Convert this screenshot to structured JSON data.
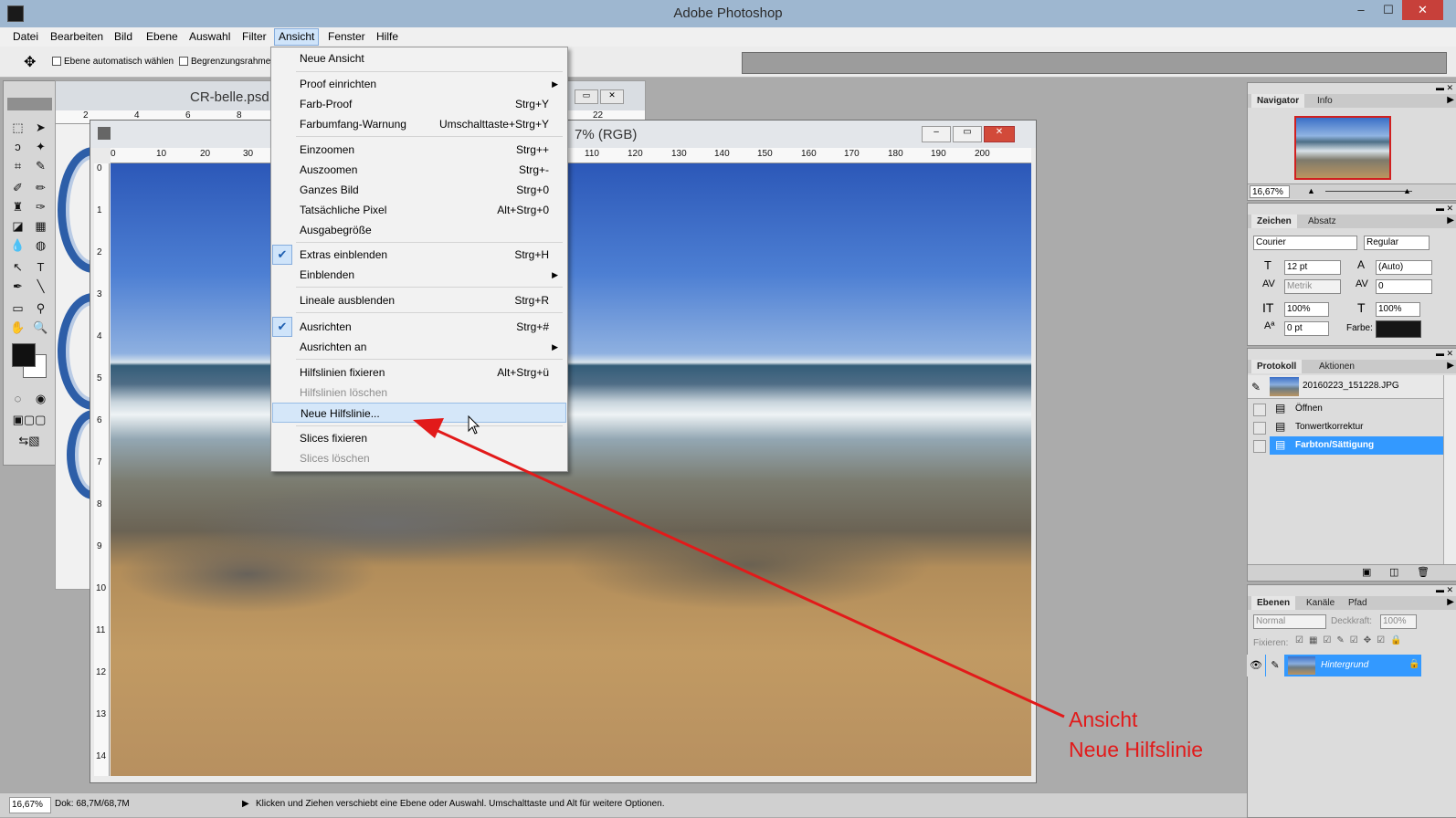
{
  "app": {
    "title": "Adobe Photoshop",
    "win_min": "–",
    "win_max": "☐",
    "win_close": "✕"
  },
  "menubar": {
    "items": [
      "Datei",
      "Bearbeiten",
      "Bild",
      "Ebene",
      "Auswahl",
      "Filter",
      "Ansicht",
      "Fenster",
      "Hilfe"
    ],
    "active": "Ansicht"
  },
  "options": {
    "auto_select_label": "Ebene automatisch wählen",
    "bounds_label": "Begrenzungsrahmen"
  },
  "back_doc": {
    "title": "CR-belle.psd",
    "ruler": [
      "2",
      "4",
      "6",
      "8",
      "22"
    ]
  },
  "main_doc": {
    "title": "7% (RGB)",
    "ruler_top": [
      "0",
      "10",
      "20",
      "30",
      "110",
      "120",
      "130",
      "140",
      "150",
      "160",
      "170",
      "180",
      "190",
      "200"
    ],
    "ruler_left": [
      "0",
      "1",
      "2",
      "3",
      "4",
      "5",
      "6",
      "7",
      "8",
      "9",
      "10",
      "11",
      "12",
      "13",
      "14"
    ]
  },
  "view_menu": {
    "items": [
      {
        "label": "Neue Ansicht",
        "shortcut": ""
      },
      {
        "label": "Proof einrichten",
        "shortcut": "",
        "submenu": true
      },
      {
        "label": "Farb-Proof",
        "shortcut": "Strg+Y"
      },
      {
        "label": "Farbumfang-Warnung",
        "shortcut": "Umschalttaste+Strg+Y"
      },
      {
        "label": "Einzoomen",
        "shortcut": "Strg++"
      },
      {
        "label": "Auszoomen",
        "shortcut": "Strg+-"
      },
      {
        "label": "Ganzes Bild",
        "shortcut": "Strg+0"
      },
      {
        "label": "Tatsächliche Pixel",
        "shortcut": "Alt+Strg+0"
      },
      {
        "label": "Ausgabegröße",
        "shortcut": ""
      },
      {
        "label": "Extras einblenden",
        "shortcut": "Strg+H",
        "checked": true
      },
      {
        "label": "Einblenden",
        "shortcut": "",
        "submenu": true
      },
      {
        "label": "Lineale ausblenden",
        "shortcut": "Strg+R"
      },
      {
        "label": "Ausrichten",
        "shortcut": "Strg+#",
        "checked": true
      },
      {
        "label": "Ausrichten an",
        "shortcut": "",
        "submenu": true
      },
      {
        "label": "Hilfslinien fixieren",
        "shortcut": "Alt+Strg+ü"
      },
      {
        "label": "Hilfslinien löschen",
        "shortcut": "",
        "disabled": true
      },
      {
        "label": "Neue Hilfslinie...",
        "shortcut": "",
        "hover": true
      },
      {
        "label": "Slices fixieren",
        "shortcut": ""
      },
      {
        "label": "Slices löschen",
        "shortcut": "",
        "disabled": true
      }
    ]
  },
  "annotation": {
    "line1": "Ansicht",
    "line2": "Neue Hilfslinie",
    "color": "#e21a1a"
  },
  "navigator": {
    "tabs": [
      "Navigator",
      "Info"
    ],
    "zoom": "16,67%"
  },
  "character": {
    "tabs": [
      "Zeichen",
      "Absatz"
    ],
    "font": "Courier",
    "style": "Regular",
    "size": "12 pt",
    "leading": "(Auto)",
    "kerning": "Metrik",
    "tracking": "0",
    "vscale": "100%",
    "hscale": "100%",
    "baseline": "0 pt",
    "color_label": "Farbe:"
  },
  "history": {
    "tabs": [
      "Protokoll",
      "Aktionen"
    ],
    "snapshot": "20160223_151228.JPG",
    "steps": [
      "Öffnen",
      "Tonwertkorrektur",
      "Farbton/Sättigung"
    ],
    "active_step": "Farbton/Sättigung"
  },
  "layers": {
    "tabs": [
      "Ebenen",
      "Kanäle",
      "Pfad"
    ],
    "blend_mode": "Normal",
    "opacity_label": "Deckkraft:",
    "opacity": "100%",
    "lock_label": "Fixieren:",
    "layer_name": "Hintergrund"
  },
  "status": {
    "zoom": "16,67%",
    "doc": "Dok: 68,7M/68,7M",
    "hint": "Klicken und Ziehen verschiebt eine Ebene oder Auswahl. Umschalttaste und Alt für weitere Optionen."
  },
  "colors": {
    "selection_blue": "#3399ff",
    "menu_hover": "#d5e7f9",
    "arrow_red": "#e21a1a"
  }
}
